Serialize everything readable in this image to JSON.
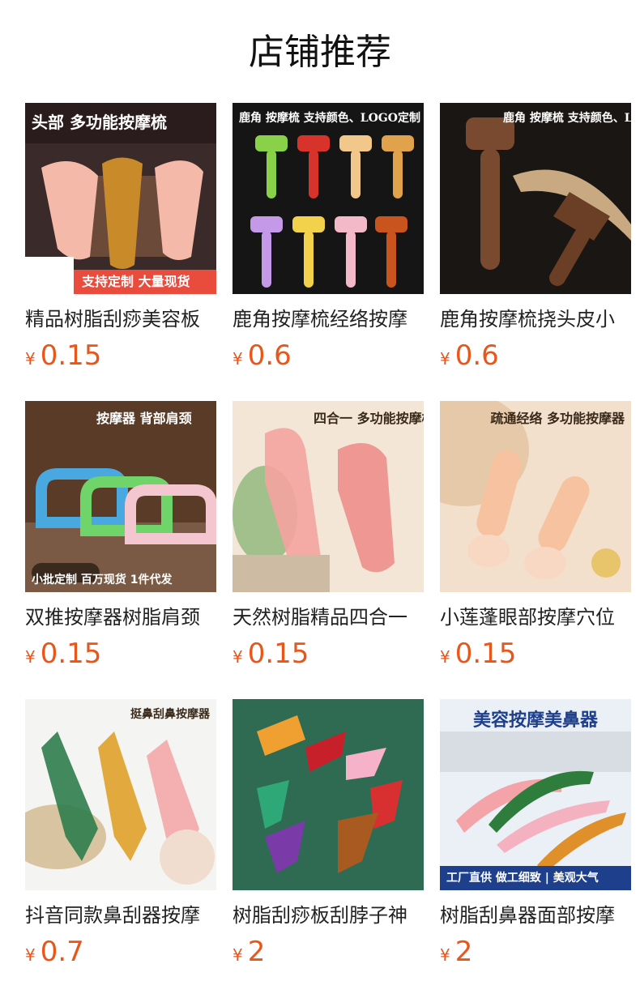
{
  "header": {
    "title": "店铺推荐"
  },
  "products": [
    {
      "name": "精品树脂刮痧美容板",
      "currency": "¥",
      "price": "0.15",
      "image": {
        "banner": "头部 多功能按摩梳",
        "tagline": "支持定制 大量现货",
        "bg": "#3a2a2a",
        "accent": "#e94b3c"
      }
    },
    {
      "name": "鹿角按摩梳经络按摩",
      "currency": "¥",
      "price": "0.6",
      "image": {
        "banner": "鹿角 按摩梳 支持颜色、LOGO定制",
        "tagline": "",
        "bg": "#151515",
        "accent": "#c8312b"
      }
    },
    {
      "name": "鹿角按摩梳挠头皮小",
      "currency": "¥",
      "price": "0.6",
      "image": {
        "banner": "鹿角 按摩梳 支持颜色、LOGO定制",
        "tagline": "",
        "bg": "#1a1614",
        "accent": "#7a4a30"
      }
    },
    {
      "name": "双推按摩器树脂肩颈",
      "currency": "¥",
      "price": "0.15",
      "image": {
        "banner": "按摩器 背部肩颈",
        "tagline": "小批定制  百万现货 1件代发",
        "bg": "#5a3b28",
        "accent": "#4aa8e0"
      }
    },
    {
      "name": "天然树脂精品四合一",
      "currency": "¥",
      "price": "0.15",
      "image": {
        "banner": "四合一 多功能按摩梳",
        "tagline": "",
        "bg": "#f3e6d6",
        "accent": "#f4a3a0"
      }
    },
    {
      "name": "小莲蓬眼部按摩穴位",
      "currency": "¥",
      "price": "0.15",
      "image": {
        "banner": "疏通经络 多功能按摩器",
        "tagline": "",
        "bg": "#f2dfcc",
        "accent": "#f1b28a"
      }
    },
    {
      "name": "抖音同款鼻刮器按摩",
      "currency": "¥",
      "price": "0.7",
      "image": {
        "banner": "挺鼻刮鼻按摩器",
        "tagline": "",
        "bg": "#f4f4f2",
        "accent": "#2f7d4c"
      }
    },
    {
      "name": "树脂刮痧板刮脖子神",
      "currency": "¥",
      "price": "2",
      "image": {
        "banner": "",
        "tagline": "",
        "bg": "#2f6b52",
        "accent": "#e86f2c"
      }
    },
    {
      "name": "树脂刮鼻器面部按摩",
      "currency": "¥",
      "price": "2",
      "image": {
        "banner": "美容按摩美鼻器",
        "tagline": "工厂直供  做工细致 | 美观大气",
        "bg": "#eaf0f6",
        "accent": "#1e3f8c"
      }
    }
  ]
}
